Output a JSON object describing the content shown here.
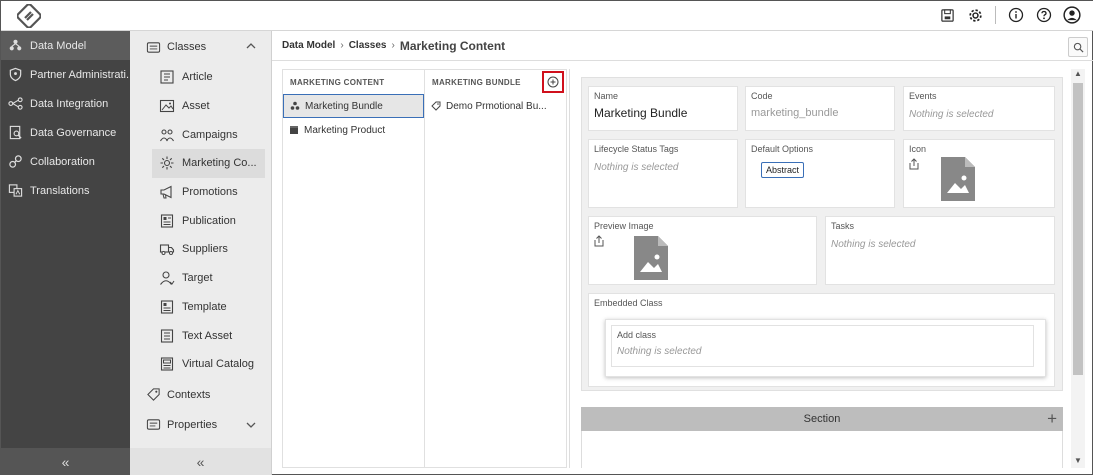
{
  "nav": {
    "items": [
      {
        "label": "Data Model",
        "icon": "data-model-icon"
      },
      {
        "label": "Partner Administrati...",
        "icon": "shield-icon"
      },
      {
        "label": "Data Integration",
        "icon": "integration-icon"
      },
      {
        "label": "Data Governance",
        "icon": "governance-icon"
      },
      {
        "label": "Collaboration",
        "icon": "collaboration-icon"
      },
      {
        "label": "Translations",
        "icon": "translations-icon"
      }
    ],
    "collapse_label": "«"
  },
  "subnav": {
    "classes_label": "Classes",
    "items": [
      {
        "label": "Article"
      },
      {
        "label": "Asset"
      },
      {
        "label": "Campaigns"
      },
      {
        "label": "Marketing Co..."
      },
      {
        "label": "Promotions"
      },
      {
        "label": "Publication"
      },
      {
        "label": "Suppliers"
      },
      {
        "label": "Target"
      },
      {
        "label": "Template"
      },
      {
        "label": "Text Asset"
      },
      {
        "label": "Virtual Catalog"
      }
    ],
    "contexts_label": "Contexts",
    "properties_label": "Properties",
    "collapse_label": "«"
  },
  "breadcrumb": {
    "level1": "Data Model",
    "level2": "Classes",
    "current": "Marketing Content",
    "sep": "›"
  },
  "columns": {
    "col1_header": "MARKETING CONTENT",
    "col1_items": [
      "Marketing Bundle",
      "Marketing Product"
    ],
    "col2_header": "MARKETING BUNDLE",
    "col2_items": [
      "Demo Prmotional Bu..."
    ]
  },
  "detail": {
    "name_label": "Name",
    "name_value": "Marketing Bundle",
    "code_label": "Code",
    "code_value": "marketing_bundle",
    "events_label": "Events",
    "events_value": "Nothing is selected",
    "lifecycle_label": "Lifecycle Status Tags",
    "lifecycle_value": "Nothing is selected",
    "default_options_label": "Default Options",
    "default_options_chip": "Abstract",
    "icon_label": "Icon",
    "preview_label": "Preview Image",
    "tasks_label": "Tasks",
    "tasks_value": "Nothing is selected",
    "embedded_label": "Embedded Class",
    "add_class_label": "Add class",
    "add_class_value": "Nothing is selected",
    "section_label": "Section",
    "section_plus": "+"
  },
  "colors": {
    "nav_bg": "#444444",
    "selected_border": "#3a6fb7",
    "highlight_red": "#d0101c"
  }
}
